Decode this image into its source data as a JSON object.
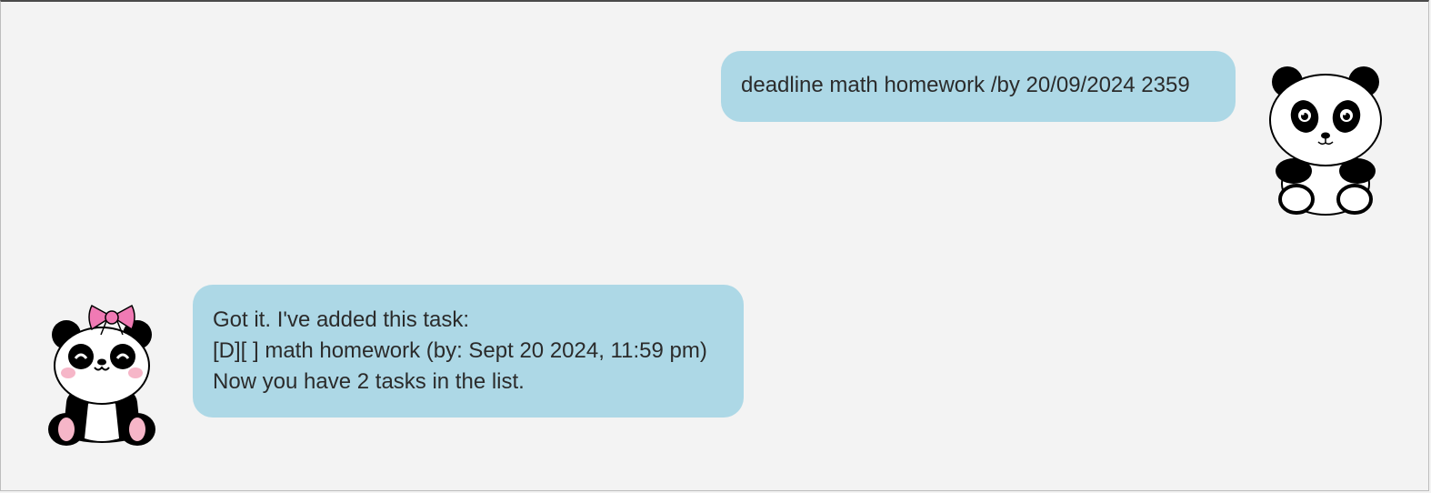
{
  "dialog": {
    "user_message": {
      "text": "deadline math homework /by 20/09/2024 2359",
      "avatar": "panda-avatar"
    },
    "bot_message": {
      "lines": [
        "Got it. I've added this task:",
        "[D][ ] math homework (by: Sept 20 2024, 11:59 pm)",
        "Now you have 2 tasks in the list."
      ],
      "avatar": "panda-with-bow-avatar"
    }
  },
  "colors": {
    "background": "#f3f3f3",
    "bubble": "#add8e6",
    "bow": "#f07ab4"
  }
}
